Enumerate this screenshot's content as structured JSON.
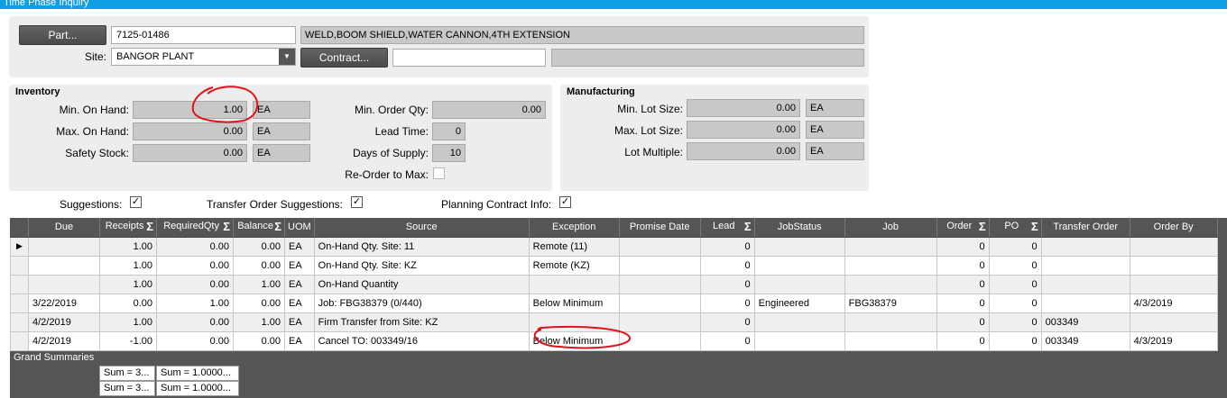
{
  "window": {
    "title": "Time Phase Inquiry"
  },
  "header": {
    "part_button": "Part...",
    "part_value": "7125-01486",
    "part_description": "WELD,BOOM SHIELD,WATER CANNON,4TH EXTENSION",
    "site_label": "Site:",
    "site_value": "BANGOR PLANT",
    "contract_button": "Contract...",
    "contract_value": "",
    "contract_description": ""
  },
  "inventory": {
    "title": "Inventory",
    "min_on_hand_label": "Min. On Hand:",
    "min_on_hand": "1.00",
    "min_on_hand_uom": "EA",
    "max_on_hand_label": "Max. On Hand:",
    "max_on_hand": "0.00",
    "max_on_hand_uom": "EA",
    "safety_stock_label": "Safety Stock:",
    "safety_stock": "0.00",
    "safety_stock_uom": "EA",
    "min_order_qty_label": "Min. Order Qty:",
    "min_order_qty": "0.00",
    "lead_time_label": "Lead Time:",
    "lead_time": "0",
    "days_of_supply_label": "Days of Supply:",
    "days_of_supply": "10",
    "reorder_to_max_label": "Re-Order to Max:",
    "reorder_to_max": false
  },
  "manufacturing": {
    "title": "Manufacturing",
    "min_lot_size_label": "Min. Lot Size:",
    "min_lot_size": "0.00",
    "min_lot_size_uom": "EA",
    "max_lot_size_label": "Max. Lot Size:",
    "max_lot_size": "0.00",
    "max_lot_size_uom": "EA",
    "lot_multiple_label": "Lot Multiple:",
    "lot_multiple": "0.00",
    "lot_multiple_uom": "EA"
  },
  "options": {
    "suggestions_label": "Suggestions:",
    "suggestions": true,
    "transfer_order_suggestions_label": "Transfer Order Suggestions:",
    "transfer_order_suggestions": true,
    "planning_contract_info_label": "Planning Contract Info:",
    "planning_contract_info": true
  },
  "grid": {
    "columns": [
      {
        "label": ""
      },
      {
        "label": "Due"
      },
      {
        "label": "Receipts",
        "sum": true
      },
      {
        "label": "RequiredQty",
        "sum": true
      },
      {
        "label": "Balance",
        "sum": true
      },
      {
        "label": "UOM"
      },
      {
        "label": "Source"
      },
      {
        "label": "Exception"
      },
      {
        "label": "Promise Date"
      },
      {
        "label": "Lead",
        "sum": true
      },
      {
        "label": "JobStatus"
      },
      {
        "label": "Job"
      },
      {
        "label": "Order",
        "sum": true
      },
      {
        "label": "PO",
        "sum": true
      },
      {
        "label": "Transfer Order"
      },
      {
        "label": "Order By"
      }
    ],
    "rows": [
      {
        "due": "",
        "receipts": "1.00",
        "required": "0.00",
        "balance": "0.00",
        "uom": "EA",
        "source": "On-Hand Qty. Site: 11",
        "exception": "Remote (11)",
        "promise": "",
        "lead": "0",
        "job_status": "",
        "job": "",
        "order": "0",
        "po": "0",
        "transfer_order": "",
        "order_by": ""
      },
      {
        "due": "",
        "receipts": "1.00",
        "required": "0.00",
        "balance": "0.00",
        "uom": "EA",
        "source": "On-Hand Qty. Site: KZ",
        "exception": "Remote (KZ)",
        "promise": "",
        "lead": "0",
        "job_status": "",
        "job": "",
        "order": "0",
        "po": "0",
        "transfer_order": "",
        "order_by": ""
      },
      {
        "due": "",
        "receipts": "1.00",
        "required": "0.00",
        "balance": "1.00",
        "uom": "EA",
        "source": "On-Hand Quantity",
        "exception": "",
        "promise": "",
        "lead": "0",
        "job_status": "",
        "job": "",
        "order": "0",
        "po": "0",
        "transfer_order": "",
        "order_by": ""
      },
      {
        "due": "3/22/2019",
        "receipts": "0.00",
        "required": "1.00",
        "balance": "0.00",
        "uom": "EA",
        "source": "Job: FBG38379 (0/440)",
        "exception": "Below Minimum",
        "promise": "",
        "lead": "0",
        "job_status": "Engineered",
        "job": "FBG38379",
        "order": "0",
        "po": "0",
        "transfer_order": "",
        "order_by": "4/3/2019"
      },
      {
        "due": "4/2/2019",
        "receipts": "1.00",
        "required": "0.00",
        "balance": "1.00",
        "uom": "EA",
        "source": "Firm Transfer from Site: KZ",
        "exception": "",
        "promise": "",
        "lead": "0",
        "job_status": "",
        "job": "",
        "order": "0",
        "po": "0",
        "transfer_order": "003349",
        "order_by": ""
      },
      {
        "due": "4/2/2019",
        "receipts": "-1.00",
        "required": "0.00",
        "balance": "0.00",
        "uom": "EA",
        "source": "Cancel TO: 003349/16",
        "exception": "Below Minimum",
        "promise": "",
        "lead": "0",
        "job_status": "",
        "job": "",
        "order": "0",
        "po": "0",
        "transfer_order": "003349",
        "order_by": "4/3/2019"
      }
    ],
    "grand_summaries_label": "Grand Summaries",
    "summaries": [
      {
        "receipts": "Sum = 3...",
        "required": "Sum = 1.0000..."
      },
      {
        "receipts": "Sum = 3...",
        "required": "Sum = 1.0000..."
      }
    ]
  },
  "annotation_color": "#e0121a"
}
